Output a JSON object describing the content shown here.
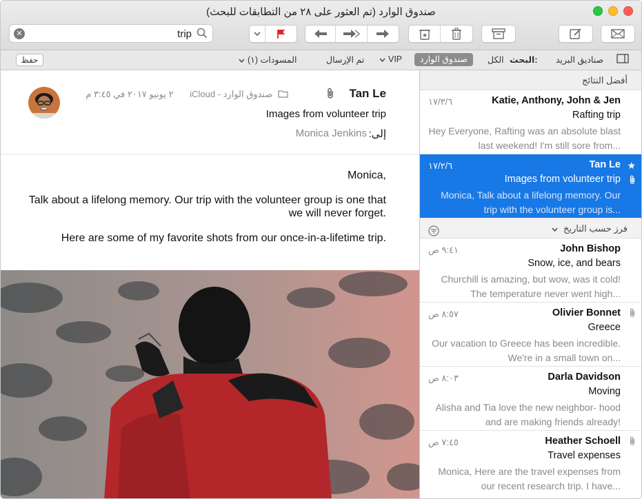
{
  "window": {
    "title": "صندوق الوارد  (تم العثور على ٢٨ من التطابقات للبحث)"
  },
  "toolbar": {
    "search_value": "trip",
    "icons": [
      "close-circle-icon",
      "search-icon",
      "chevron-down-icon",
      "flag-icon",
      "reply-icon",
      "reply-all-icon",
      "forward-icon",
      "junk-icon",
      "trash-icon",
      "archive-icon",
      "compose-icon",
      "get-mail-icon"
    ],
    "flag_color": "#e0262b"
  },
  "favbar": {
    "save": "حفظ",
    "mailboxes": "صناديق البريد",
    "search_label": "البحث:",
    "all": "الكل",
    "inbox": "صندوق الوارد",
    "vip": "VIP",
    "sent": "تم الإرسال",
    "drafts": "المسودات (١)"
  },
  "list": {
    "top_hits": "أفضل النتائج",
    "sort": "فرز حسب التاريخ",
    "messages": [
      {
        "from": "Katie, Anthony, John & Jen",
        "date": "١٧/٣/٦",
        "subject": "Rafting trip",
        "preview": "Hey Everyone, Rafting was an absolute blast last weekend! I'm still sore from..."
      },
      {
        "from": "Tan Le",
        "date": "١٧/٢/٦",
        "subject": "Images from volunteer trip",
        "preview": "Monica, Talk about a lifelong memory. Our trip with the volunteer group is..."
      },
      {
        "from": "John Bishop",
        "date": "٩:٤١ ص",
        "subject": "Snow, ice, and bears",
        "preview": "Churchill is amazing, but wow, was it cold! The temperature never went high..."
      },
      {
        "from": "Olivier Bonnet",
        "date": "٨:٥٧ ص",
        "subject": "Greece",
        "preview": "Our vacation to Greece has been incredible. We're in a small town on..."
      },
      {
        "from": "Darla Davidson",
        "date": "٨:٠٣ ص",
        "subject": "Moving",
        "preview": "Alisha and Tia love the new neighbor- hood and are making friends already!"
      },
      {
        "from": "Heather Schoell",
        "date": "٧:٤٥ ص",
        "subject": "Travel expenses",
        "preview": "Monica, Here are the travel expenses from our recent research trip. I have..."
      }
    ],
    "selected_color": "#1878e6"
  },
  "reader": {
    "sender": "Tan Le",
    "mailbox": "صندوق الوارد - iCloud",
    "date": "٢ يونيو ٢٠١٧ في ٣:٤٥ م",
    "subject": "Images from volunteer trip",
    "to_label": "إلى:",
    "to_name": "Monica Jenkins",
    "body": [
      "Monica,",
      "Talk about a lifelong memory. Our trip with the volunteer group is one that we will never forget.",
      "Here are some of my favorite shots from our once-in-a-lifetime trip."
    ]
  }
}
